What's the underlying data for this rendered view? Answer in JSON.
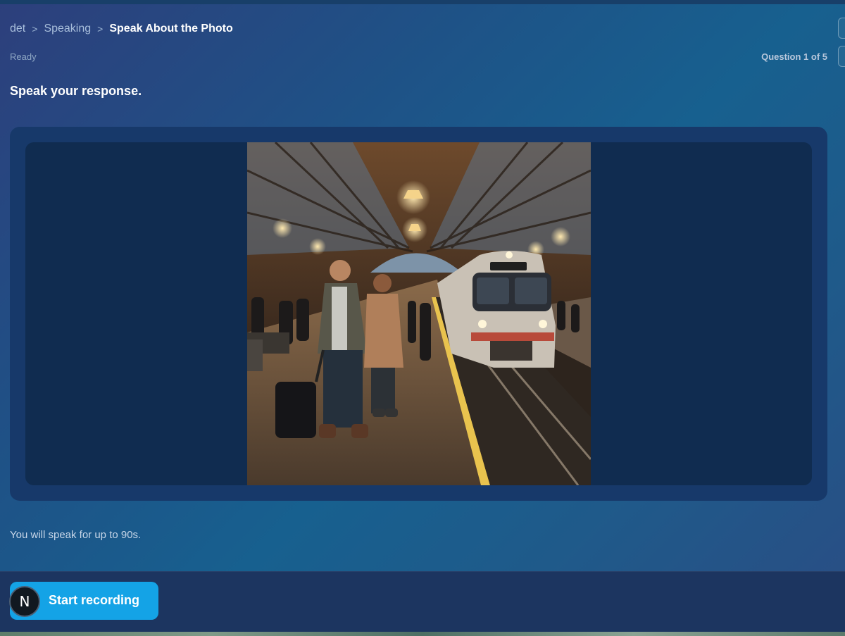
{
  "breadcrumb": {
    "items": [
      "det",
      "Speaking"
    ],
    "separator": ">",
    "current": "Speak About the Photo"
  },
  "status": {
    "state": "Ready",
    "progress_text": "Question 1 of 5"
  },
  "prompt": {
    "instruction": "Speak your response."
  },
  "photo": {
    "icon": "photo-train-platform"
  },
  "hint": "You will speak for up to 90s.",
  "footer": {
    "record_button_label": "Start recording",
    "badge_letter": "N"
  },
  "colors": {
    "accent": "#14a3e6",
    "card": "#17396a",
    "frame": "#102c50"
  }
}
